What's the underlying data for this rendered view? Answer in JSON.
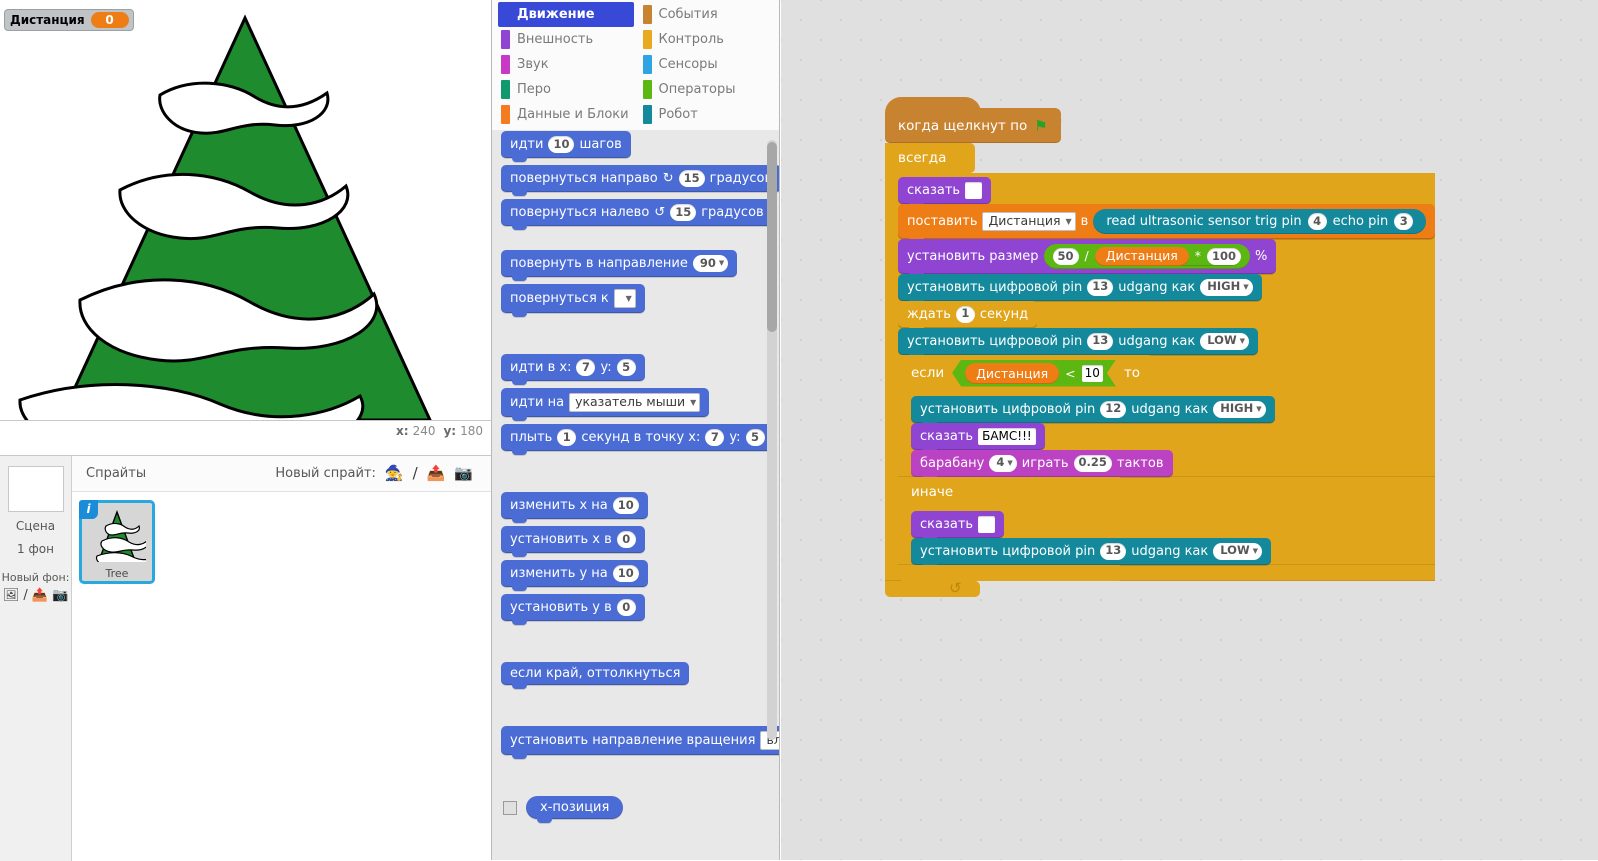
{
  "stage": {
    "watcher": {
      "label": "Дистанция",
      "value": "0"
    },
    "coords": {
      "x_label": "x:",
      "x_value": "240",
      "y_label": "y:",
      "y_value": "180"
    },
    "sprite_name": "Tree"
  },
  "sprite_pane": {
    "stage_panel": {
      "title": "Сцена",
      "subtitle": "1 фон",
      "new_backdrop_label": "Новый фон:",
      "icons": [
        "picture-icon",
        "paint-icon",
        "upload-icon",
        "camera-icon"
      ]
    },
    "header": {
      "title": "Спрайты",
      "new_sprite_label": "Новый спрайт:",
      "icons": [
        "surprise-sprite-icon",
        "paint-sprite-icon",
        "upload-sprite-icon",
        "camera-sprite-icon"
      ]
    },
    "sprites": [
      {
        "name": "Tree",
        "badge": "i",
        "selected": true
      }
    ]
  },
  "palette": {
    "categories": [
      {
        "label": "Движение",
        "color": "#4a6cd4",
        "selected": true
      },
      {
        "label": "События",
        "color": "#c88330",
        "selected": false
      },
      {
        "label": "Внешность",
        "color": "#8f45d1",
        "selected": false
      },
      {
        "label": "Контроль",
        "color": "#e0a51b",
        "selected": false
      },
      {
        "label": "Звук",
        "color": "#bb42c3",
        "selected": false
      },
      {
        "label": "Сенсоры",
        "color": "#2ca5e2",
        "selected": false
      },
      {
        "label": "Перо",
        "color": "#0e9a6c",
        "selected": false
      },
      {
        "label": "Операторы",
        "color": "#5cb712",
        "selected": false
      },
      {
        "label": "Данные и Блоки",
        "color": "#ee7d16",
        "selected": false
      },
      {
        "label": "Робот",
        "color": "#14899c",
        "selected": false
      }
    ],
    "blocks": {
      "move": {
        "a": "идти",
        "n": "10",
        "b": "шагов"
      },
      "turn_right": {
        "a": "повернуться направо",
        "icon": "turn-cw-icon",
        "n": "15",
        "b": "градусов"
      },
      "turn_left": {
        "a": "повернуться налево",
        "icon": "turn-ccw-icon",
        "n": "15",
        "b": "градусов"
      },
      "point_dir": {
        "a": "повернуть в направление",
        "n": "90"
      },
      "point_to": {
        "a": "повернуться к",
        "n": ""
      },
      "goto_xy": {
        "a": "идти в x:",
        "x": "7",
        "b": "y:",
        "y": "5"
      },
      "goto_target": {
        "a": "идти на",
        "n": "указатель мыши"
      },
      "glide": {
        "a": "плыть",
        "secs": "1",
        "b": "секунд в точку x:",
        "x": "7",
        "c": "y:",
        "y": "5"
      },
      "change_x": {
        "a": "изменить x на",
        "n": "10"
      },
      "set_x": {
        "a": "установить x в",
        "n": "0"
      },
      "change_y": {
        "a": "изменить y на",
        "n": "10"
      },
      "set_y": {
        "a": "установить y в",
        "n": "0"
      },
      "bounce": {
        "a": "если край, оттолкнуться"
      },
      "rot_style": {
        "a": "установить направление вращения",
        "n": "вл"
      },
      "x_position": {
        "a": "x-позиция"
      }
    }
  },
  "script": {
    "hat": {
      "label": "когда щелкнут по",
      "icon": "green-flag-icon"
    },
    "forever": {
      "label": "всегда"
    },
    "say1": {
      "label": "сказать",
      "value": ""
    },
    "set_var": {
      "a": "поставить",
      "var": "Дистанция",
      "b": "в"
    },
    "sensor": {
      "a": "read ultrasonic sensor trig pin",
      "trig": "4",
      "b": "echo pin",
      "echo": "3"
    },
    "set_size": {
      "a": "установить размер",
      "n1": "50",
      "op1": "/",
      "var": "Дистанция",
      "op2": "*",
      "n2": "100",
      "pct": "%"
    },
    "pin13_high": {
      "a": "установить цифровой pin",
      "pin": "13",
      "b": "udgang как",
      "val": "HIGH"
    },
    "wait": {
      "a": "ждать",
      "n": "1",
      "b": "секунд"
    },
    "pin13_low": {
      "a": "установить цифровой pin",
      "pin": "13",
      "b": "udgang как",
      "val": "LOW"
    },
    "if": {
      "label": "если",
      "var": "Дистанция",
      "op": "<",
      "n": "10",
      "then": "то"
    },
    "pin12_high": {
      "a": "установить цифровой pin",
      "pin": "12",
      "b": "udgang как",
      "val": "HIGH"
    },
    "say2": {
      "label": "сказать",
      "value": "БАМС!!!"
    },
    "drum": {
      "a": "барабану",
      "n": "4",
      "b": "играть",
      "beats": "0.25",
      "c": "тактов"
    },
    "else": {
      "label": "иначе"
    },
    "say3": {
      "label": "сказать",
      "value": ""
    },
    "pin13_low2": {
      "a": "установить цифровой pin",
      "pin": "13",
      "b": "udgang как",
      "val": "LOW"
    }
  }
}
